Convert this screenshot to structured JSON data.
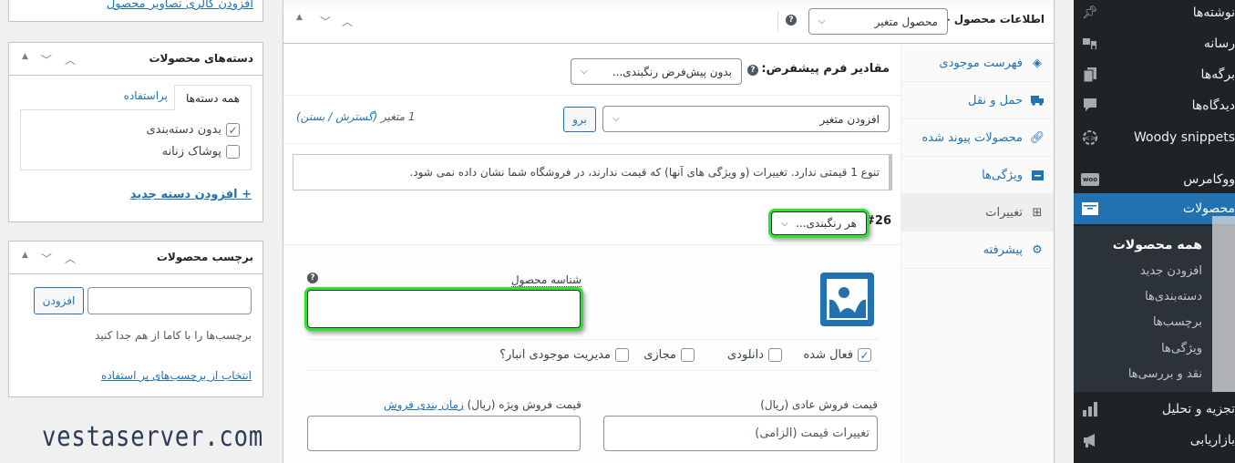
{
  "admin_menu": {
    "items": [
      {
        "label": "نوشته‌ها",
        "icon": "pin-icon"
      },
      {
        "label": "رسانه",
        "icon": "media-icon"
      },
      {
        "label": "برگه‌ها",
        "icon": "pages-icon"
      },
      {
        "label": "دیدگاه‌ها",
        "icon": "comments-icon"
      },
      {
        "label": "Woody snippets",
        "icon": "snippets-icon"
      },
      {
        "label": "ووکامرس",
        "icon": "woo-icon"
      },
      {
        "label": "محصولات",
        "icon": "archive-icon"
      }
    ],
    "submenu": [
      "همه محصولات",
      "افزودن جدید",
      "دسته‌بندی‌ها",
      "برچسب‌ها",
      "ویژگی‌ها",
      "نقد و بررسی‌ها"
    ],
    "bottom_items": [
      {
        "label": "تجزیه و تحلیل",
        "icon": "chart-bar-icon"
      },
      {
        "label": "بازاریابی",
        "icon": "megaphone-icon"
      }
    ],
    "accent_color": "#2271b1"
  },
  "product_data": {
    "title": "اطلاعات محصول —",
    "product_type": "محصول متغیر",
    "tabs": [
      {
        "label": "فهرست موجودی",
        "icon": "inventory-icon"
      },
      {
        "label": "حمل و نقل",
        "icon": "truck-icon"
      },
      {
        "label": "محصولات پیوند شده",
        "icon": "link-icon"
      },
      {
        "label": "ویژگی‌ها",
        "icon": "attributes-icon"
      },
      {
        "label": "تغییرات",
        "icon": "grid-icon"
      },
      {
        "label": "پیشرفته",
        "icon": "gear-icon"
      }
    ],
    "active_tab": "تغییرات",
    "default_form_label": "مقادیر فرم پیشفرض:",
    "default_form_value": "بدون پیش‌فرض رنگبندی...",
    "add_variation_select": "افزودن متغیر",
    "go_button": "برو",
    "variation_count": "1 متغیر",
    "expand_collapse": "(گسترش / بستن)",
    "notice": "تنوع 1 قیمتی ندارد. تغییرات (و ویژگی های آنها) که قیمت ندارند، در فروشگاه شما نشان داده نمی شود.",
    "variation": {
      "id": "#26",
      "attribute_value": "هر رنگبندی...",
      "sku_label": "شناسه محصول",
      "sku_value": "",
      "checkboxes": [
        {
          "label": "فعال شده",
          "checked": true
        },
        {
          "label": "دانلودی",
          "checked": false
        },
        {
          "label": "مجازی",
          "checked": false
        },
        {
          "label": "مدیریت موجودی انبار؟",
          "checked": false
        }
      ],
      "regular_price_label": "قیمت فروش عادی (ریال)",
      "regular_price_placeholder": "تغییرات قیمت (الزامی)",
      "sale_price_label": "قیمت فروش ویژه (ریال)",
      "sale_schedule_link": "زمان بندی فروش",
      "sale_price_value": ""
    }
  },
  "gallery_box": {
    "link": "افزودن گالری تصاویر محصول"
  },
  "categories_box": {
    "title": "دسته‌های محصولات",
    "tabs": [
      "همه دسته‌ها",
      "پراستفاده"
    ],
    "items": [
      {
        "label": "بدون دسته‌بندی",
        "checked": true
      },
      {
        "label": "پوشاک زنانه",
        "checked": false
      }
    ],
    "add_link": "+ افزودن دسته جدید"
  },
  "tags_box": {
    "title": "برچسب محصولات",
    "input_value": "",
    "add_button": "افزودن",
    "hint": "برچسب‌ها را با کاما از هم جدا کنید",
    "popular_link": "انتخاب از برچسب‌های پر استفاده"
  },
  "watermark": "vestaserver.com"
}
